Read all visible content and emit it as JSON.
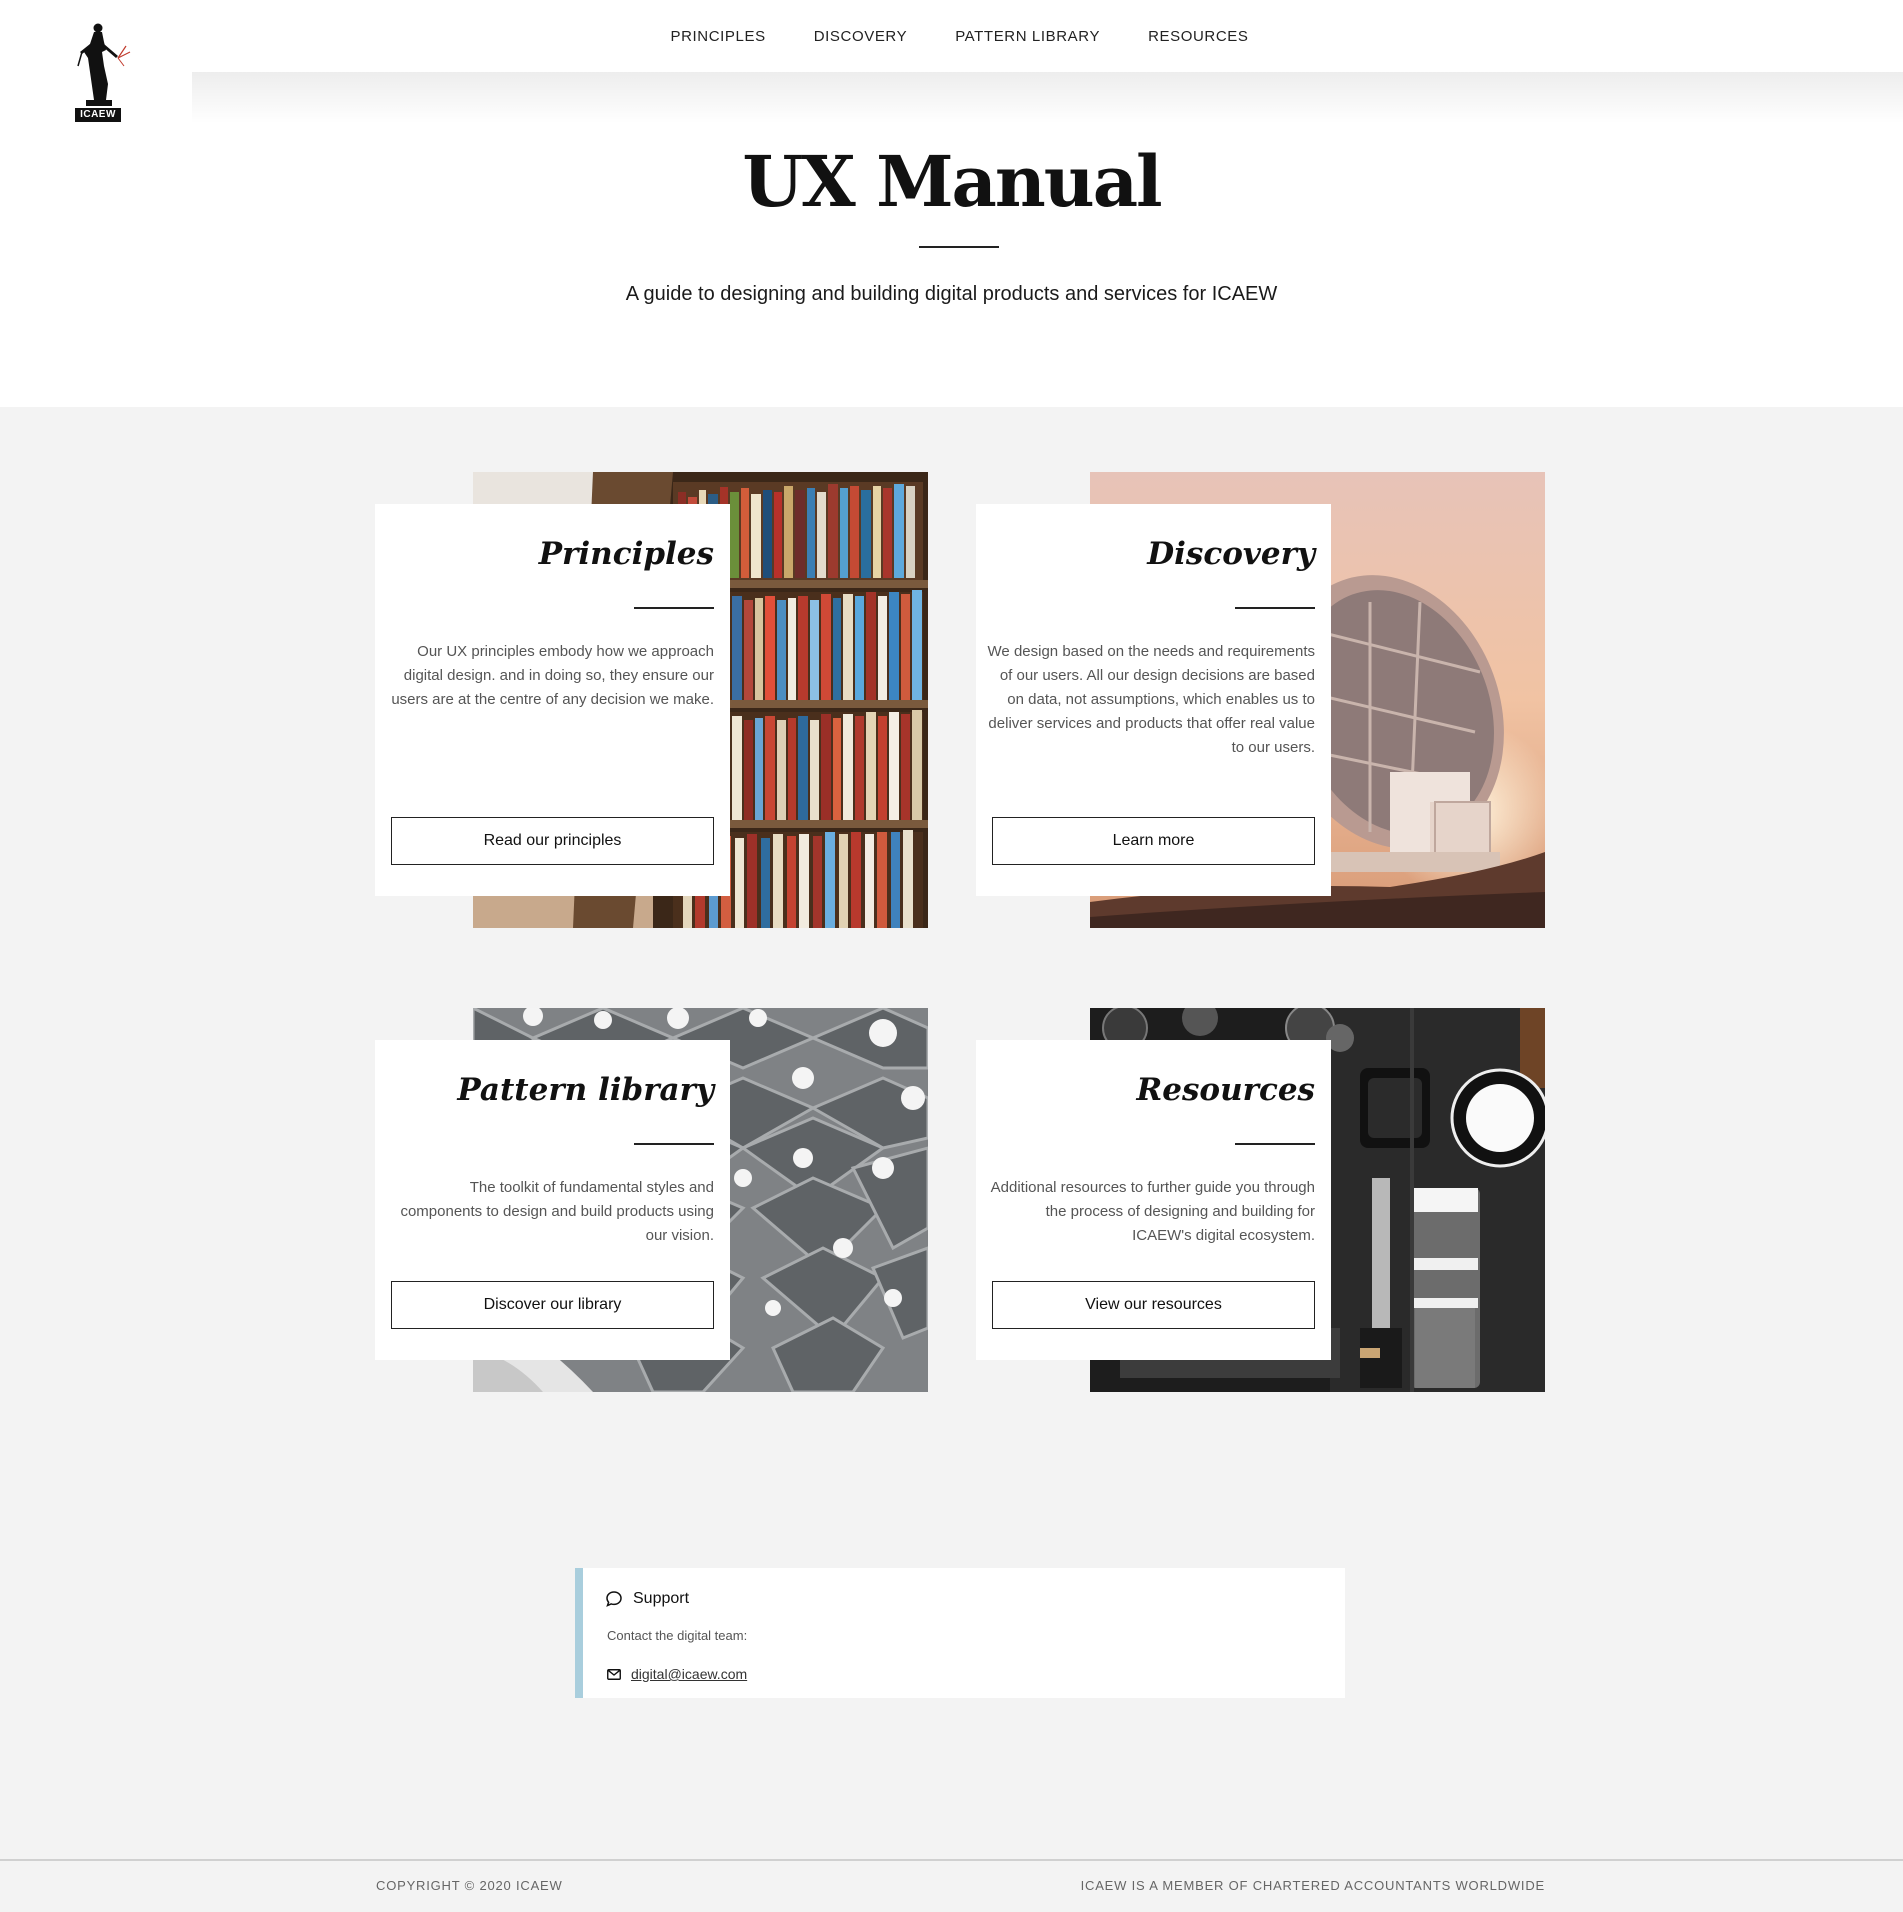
{
  "nav": {
    "items": [
      "PRINCIPLES",
      "DISCOVERY",
      "PATTERN LIBRARY",
      "RESOURCES"
    ]
  },
  "logo": {
    "text": "ICAEW",
    "icon": "statue-logo"
  },
  "hero": {
    "title": "UX Manual",
    "subtitle": "A guide to designing and building digital products and services for ICAEW"
  },
  "cards": [
    {
      "title": "Principles",
      "text": "Our UX principles embody how we approach digital design. and in doing so, they ensure our users are at the centre of any decision we make.",
      "button": "Read our principles",
      "image": "bookshelf-photo"
    },
    {
      "title": "Discovery",
      "text": "We design based on the needs and requirements of our users. All our design decisions are based on data, not assumptions, which enables us to deliver services and products that offer real value to our users.",
      "button": "Learn more",
      "image": "radio-telescope-photo"
    },
    {
      "title": "Pattern library",
      "text": "The toolkit of fundamental styles and components to design and build products using our vision.",
      "button": "Discover our library",
      "image": "ceiling-lights-photo"
    },
    {
      "title": "Resources",
      "text": "Additional resources to further guide you through the process of designing and building for ICAEW's digital ecosystem.",
      "button": "View our resources",
      "image": "tools-flatlay-photo"
    }
  ],
  "support": {
    "title": "Support",
    "text": "Contact the digital team:",
    "email": "digital@icaew.com"
  },
  "footer": {
    "left": "COPYRIGHT © 2020 ICAEW",
    "right": "ICAEW IS A MEMBER OF CHARTERED ACCOUNTANTS WORLDWIDE"
  },
  "colors": {
    "accent_border": "#a9cedd",
    "page_bg": "#f3f3f3"
  }
}
